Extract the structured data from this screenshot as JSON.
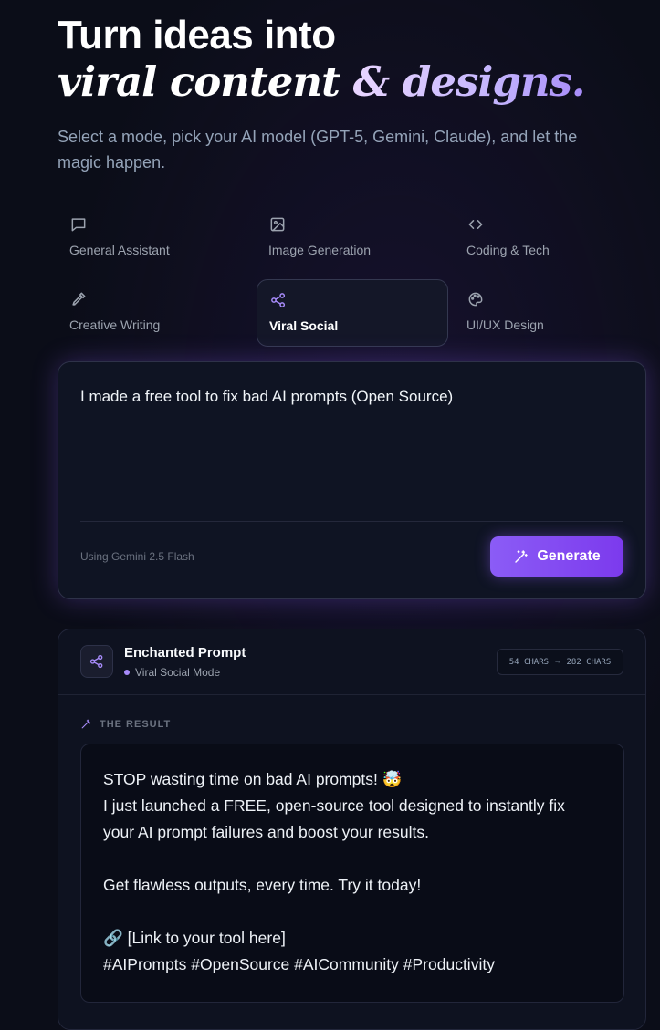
{
  "hero": {
    "title_line1": "Turn ideas into",
    "title_line2_a": "viral content",
    "title_line2_b": "& designs.",
    "subtitle": "Select a mode, pick your AI model (GPT-5, Gemini, Claude), and let the magic happen."
  },
  "modes": [
    {
      "label": "General Assistant",
      "icon": "chat-icon",
      "active": false
    },
    {
      "label": "Image Generation",
      "icon": "image-icon",
      "active": false
    },
    {
      "label": "Coding & Tech",
      "icon": "code-icon",
      "active": false
    },
    {
      "label": "Creative Writing",
      "icon": "pen-icon",
      "active": false
    },
    {
      "label": "Viral Social",
      "icon": "share-icon",
      "active": true
    },
    {
      "label": "UI/UX Design",
      "icon": "palette-icon",
      "active": false
    }
  ],
  "input": {
    "prompt_text": "I made a free tool to fix bad AI prompts (Open Source)",
    "model_note": "Using Gemini 2.5 Flash",
    "generate_label": "Generate"
  },
  "result": {
    "title": "Enchanted Prompt",
    "mode_label": "Viral Social Mode",
    "chars_before": "54 CHARS",
    "arrow": "→",
    "chars_after": "282 CHARS",
    "section_label": "THE RESULT",
    "lines": [
      "STOP wasting time on bad AI prompts! 🤯",
      "I just launched a FREE, open-source tool designed to instantly fix",
      "your AI prompt failures and boost your results.",
      "",
      "Get flawless outputs, every time. Try it today!",
      "",
      "🔗 [Link to your tool here]",
      "#AIPrompts #OpenSource #AICommunity #Productivity"
    ]
  },
  "colors": {
    "background": "#0b0d18",
    "accent": "#8b5cf6",
    "accent_light": "#a78bfa",
    "text_muted": "#94a3b8"
  }
}
